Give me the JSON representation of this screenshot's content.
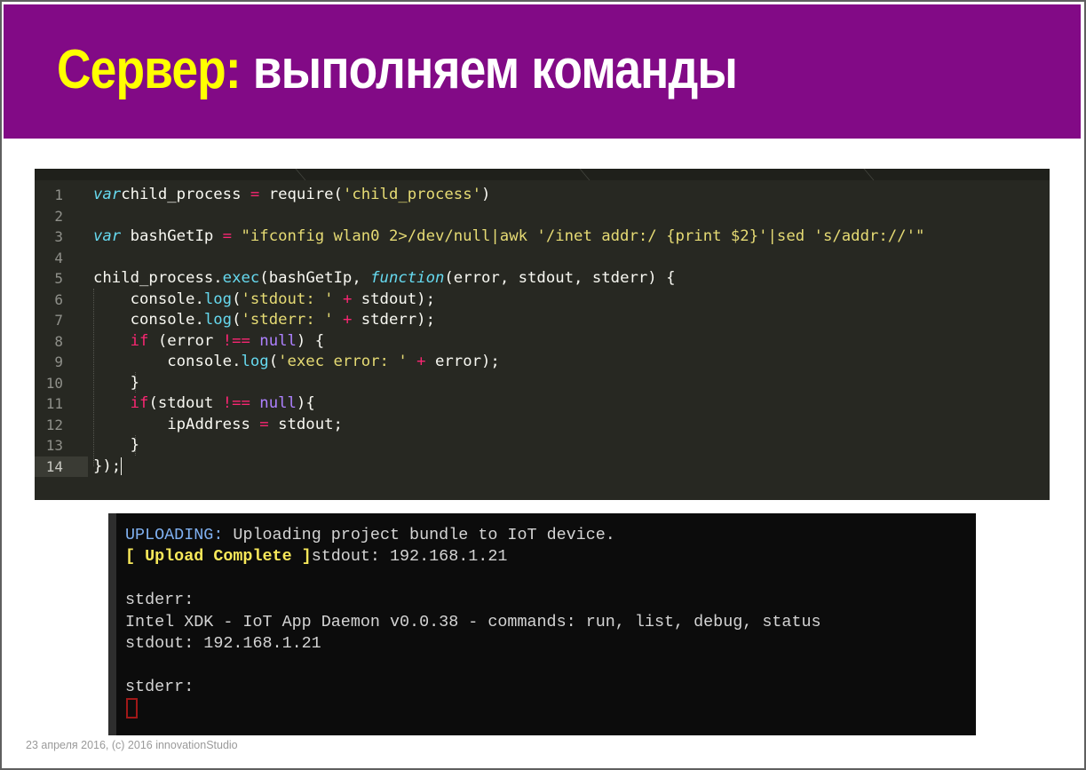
{
  "slide": {
    "title_accent": "Сервер:",
    "title_rest": " выполняем команды",
    "footer": "23 апреля 2016, (с) 2016 innovationStudio"
  },
  "colors": {
    "header_bg": "#820a86",
    "title_accent": "#ffff00",
    "editor_bg": "#272822",
    "terminal_bg": "#0c0c0c"
  },
  "editor": {
    "active_line": "14",
    "lines": [
      {
        "n": "1",
        "tokens": [
          [
            "kw-i",
            "var"
          ],
          [
            "",
            "child_process "
          ],
          [
            "op",
            "="
          ],
          [
            "",
            " require("
          ],
          [
            "str",
            "'child_process'"
          ],
          [
            "",
            ")"
          ]
        ]
      },
      {
        "n": "2",
        "tokens": []
      },
      {
        "n": "3",
        "tokens": [
          [
            "kw-i",
            "var"
          ],
          [
            "",
            " bashGetIp "
          ],
          [
            "op",
            "="
          ],
          [
            "",
            " "
          ],
          [
            "str",
            "\"ifconfig wlan0 2>/dev/null|awk '/inet addr:/ {print $2}'|sed 's/addr://'\""
          ]
        ]
      },
      {
        "n": "4",
        "tokens": []
      },
      {
        "n": "5",
        "tokens": [
          [
            "",
            "child_process."
          ],
          [
            "fn",
            "exec"
          ],
          [
            "",
            "(bashGetIp, "
          ],
          [
            "kw-i",
            "function"
          ],
          [
            "",
            "(error, stdout, stderr) {"
          ]
        ]
      },
      {
        "n": "6",
        "tokens": [
          [
            "",
            "    console."
          ],
          [
            "fn",
            "log"
          ],
          [
            "",
            "("
          ],
          [
            "str",
            "'stdout: '"
          ],
          [
            "",
            " "
          ],
          [
            "op",
            "+"
          ],
          [
            "",
            " stdout);"
          ]
        ]
      },
      {
        "n": "7",
        "tokens": [
          [
            "",
            "    console."
          ],
          [
            "fn",
            "log"
          ],
          [
            "",
            "("
          ],
          [
            "str",
            "'stderr: '"
          ],
          [
            "",
            " "
          ],
          [
            "op",
            "+"
          ],
          [
            "",
            " stderr);"
          ]
        ]
      },
      {
        "n": "8",
        "tokens": [
          [
            "",
            "    "
          ],
          [
            "kw",
            "if"
          ],
          [
            "",
            " (error "
          ],
          [
            "op",
            "!=="
          ],
          [
            "",
            " "
          ],
          [
            "cst",
            "null"
          ],
          [
            "",
            ") {"
          ]
        ]
      },
      {
        "n": "9",
        "tokens": [
          [
            "",
            "        console."
          ],
          [
            "fn",
            "log"
          ],
          [
            "",
            "("
          ],
          [
            "str",
            "'exec error: '"
          ],
          [
            "",
            " "
          ],
          [
            "op",
            "+"
          ],
          [
            "",
            " error);"
          ]
        ]
      },
      {
        "n": "10",
        "tokens": [
          [
            "",
            "    }"
          ]
        ]
      },
      {
        "n": "11",
        "tokens": [
          [
            "",
            "    "
          ],
          [
            "kw",
            "if"
          ],
          [
            "",
            "(stdout "
          ],
          [
            "op",
            "!=="
          ],
          [
            "",
            " "
          ],
          [
            "cst",
            "null"
          ],
          [
            "",
            "){"
          ]
        ]
      },
      {
        "n": "12",
        "tokens": [
          [
            "",
            "        ipAddress "
          ],
          [
            "op",
            "="
          ],
          [
            "",
            " stdout;"
          ]
        ]
      },
      {
        "n": "13",
        "tokens": [
          [
            "",
            "    }"
          ]
        ]
      },
      {
        "n": "14",
        "tokens": [
          [
            "",
            "});"
          ]
        ]
      }
    ]
  },
  "terminal": {
    "lines": [
      {
        "parts": [
          [
            "t-blue",
            "UPLOADING:"
          ],
          [
            "",
            " Uploading project bundle to IoT device."
          ]
        ]
      },
      {
        "parts": [
          [
            "t-yellow",
            "[ Upload Complete ]"
          ],
          [
            "",
            "stdout: 192.168.1.21"
          ]
        ]
      },
      {
        "parts": []
      },
      {
        "parts": [
          [
            "",
            "stderr:"
          ]
        ]
      },
      {
        "parts": [
          [
            "",
            "Intel XDK - IoT App Daemon v0.0.38 - commands: run, list, debug, status"
          ]
        ]
      },
      {
        "parts": [
          [
            "",
            "stdout: 192.168.1.21"
          ]
        ]
      },
      {
        "parts": []
      },
      {
        "parts": [
          [
            "",
            "stderr:"
          ]
        ]
      }
    ]
  }
}
